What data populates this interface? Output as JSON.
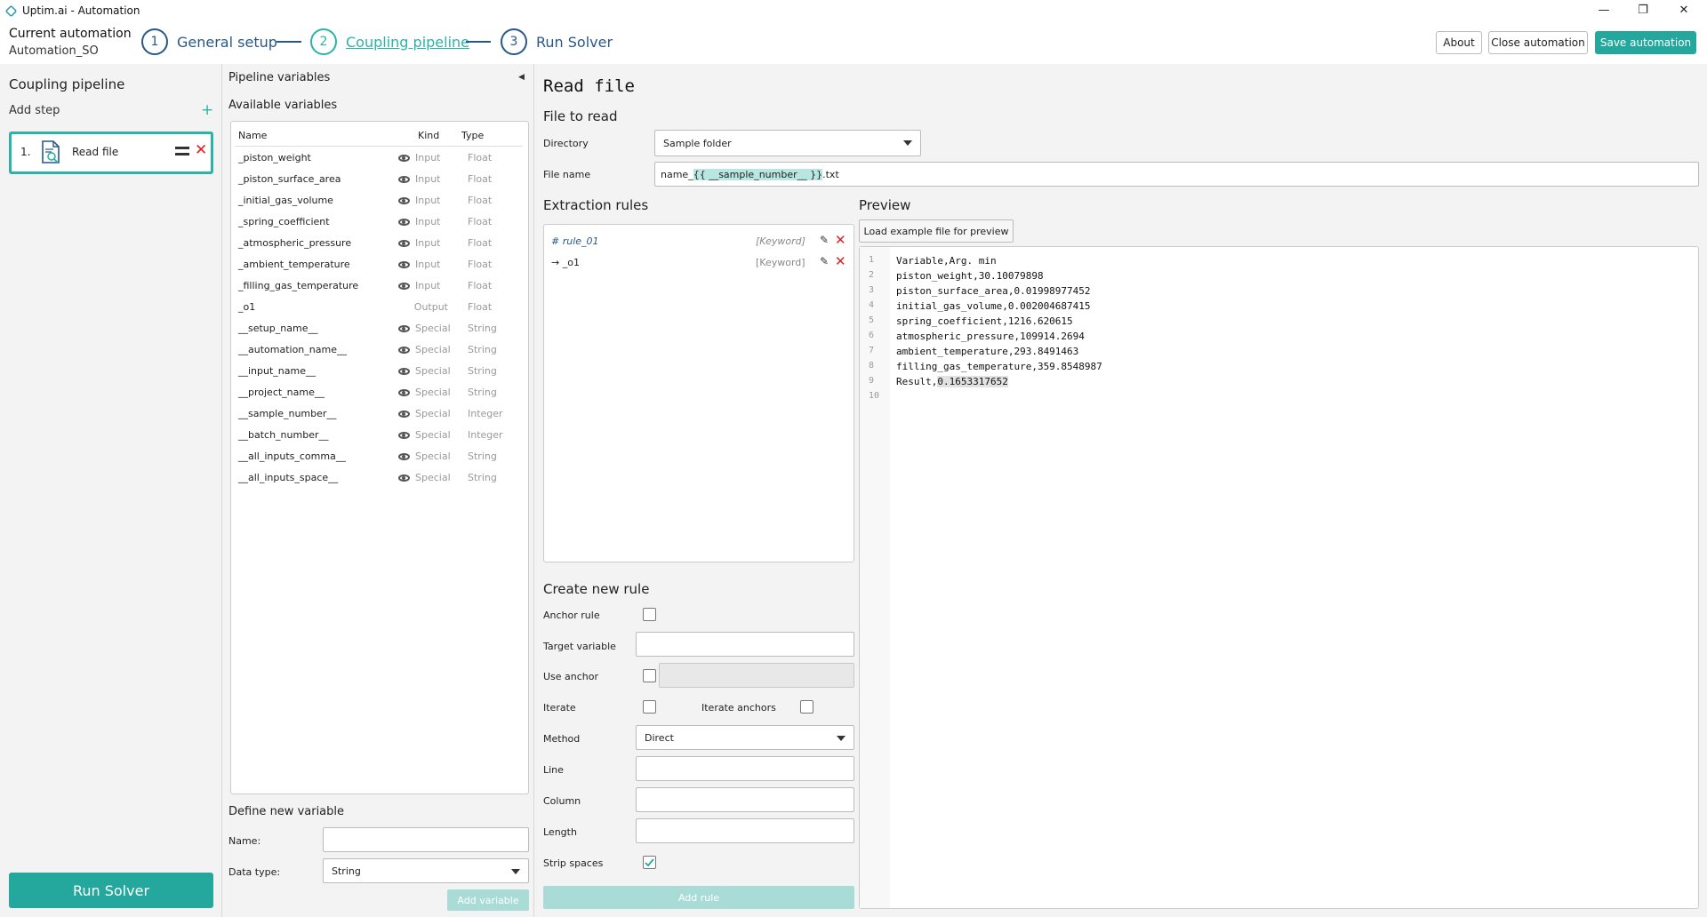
{
  "window": {
    "title": "Uptim.ai - Automation",
    "minimize": "—",
    "restore": "❐",
    "close": "✕"
  },
  "header": {
    "current_label": "Current automation",
    "current_name": "Automation_SO",
    "steps": [
      {
        "num": "1",
        "label": "General setup"
      },
      {
        "num": "2",
        "label": "Coupling pipeline"
      },
      {
        "num": "3",
        "label": "Run Solver"
      }
    ],
    "about": "About",
    "close_automation": "Close automation",
    "save_automation": "Save automation"
  },
  "sidebar": {
    "title": "Coupling pipeline",
    "add_step": "Add step",
    "plus": "+",
    "step": {
      "num": "1.",
      "name": "Read file",
      "delete": "✕"
    },
    "run_solver": "Run Solver"
  },
  "variables": {
    "panel_title": "Pipeline variables",
    "collapse": "◀",
    "available_title": "Available variables",
    "columns": {
      "name": "Name",
      "kind": "Kind",
      "type": "Type"
    },
    "rows": [
      {
        "name": "_piston_weight",
        "kind": "Input",
        "type": "Float",
        "eye": true
      },
      {
        "name": "_piston_surface_area",
        "kind": "Input",
        "type": "Float",
        "eye": true
      },
      {
        "name": "_initial_gas_volume",
        "kind": "Input",
        "type": "Float",
        "eye": true
      },
      {
        "name": "_spring_coefficient",
        "kind": "Input",
        "type": "Float",
        "eye": true
      },
      {
        "name": "_atmospheric_pressure",
        "kind": "Input",
        "type": "Float",
        "eye": true
      },
      {
        "name": "_ambient_temperature",
        "kind": "Input",
        "type": "Float",
        "eye": true
      },
      {
        "name": "_filling_gas_temperature",
        "kind": "Input",
        "type": "Float",
        "eye": true
      },
      {
        "name": "_o1",
        "kind": "Output",
        "type": "Float",
        "eye": false
      },
      {
        "name": "__setup_name__",
        "kind": "Special",
        "type": "String",
        "eye": true
      },
      {
        "name": "__automation_name__",
        "kind": "Special",
        "type": "String",
        "eye": true
      },
      {
        "name": "__input_name__",
        "kind": "Special",
        "type": "String",
        "eye": true
      },
      {
        "name": "__project_name__",
        "kind": "Special",
        "type": "String",
        "eye": true
      },
      {
        "name": "__sample_number__",
        "kind": "Special",
        "type": "Integer",
        "eye": true
      },
      {
        "name": "__batch_number__",
        "kind": "Special",
        "type": "Integer",
        "eye": true
      },
      {
        "name": "__all_inputs_comma__",
        "kind": "Special",
        "type": "String",
        "eye": true
      },
      {
        "name": "__all_inputs_space__",
        "kind": "Special",
        "type": "String",
        "eye": true
      }
    ],
    "define_title": "Define new variable",
    "name_label": "Name:",
    "datatype_label": "Data type:",
    "datatype_value": "String",
    "add_variable": "Add variable"
  },
  "main": {
    "title": "Read file",
    "file_to_read": "File to read",
    "directory_label": "Directory",
    "directory_value": "Sample folder",
    "filename_label": "File name",
    "filename_prefix": "name_",
    "filename_token": "{{ __sample_number__ }}",
    "filename_suffix": ".txt",
    "extraction_title": "Extraction rules",
    "rules": [
      {
        "name": "# rule_01",
        "tag": "[Keyword]"
      },
      {
        "name": "→ _o1",
        "tag": "[Keyword]"
      }
    ],
    "create_title": "Create new rule",
    "anchor_rule": "Anchor rule",
    "target_variable": "Target variable",
    "use_anchor": "Use anchor",
    "iterate": "Iterate",
    "iterate_anchors": "Iterate anchors",
    "method_label": "Method",
    "method_value": "Direct",
    "line_label": "Line",
    "column_label": "Column",
    "length_label": "Length",
    "strip_spaces": "Strip spaces",
    "add_rule": "Add rule",
    "preview_title": "Preview",
    "load_preview": "Load example file for preview",
    "preview_lines": [
      "Variable,Arg. min",
      "piston_weight,30.10079898",
      "piston_surface_area,0.01998977452",
      "initial_gas_volume,0.002004687415",
      "spring_coefficient,1216.620615",
      "atmospheric_pressure,109914.2694",
      "ambient_temperature,293.8491463",
      "filling_gas_temperature,359.8548987",
      "Result,",
      ""
    ],
    "highlighted_value": "0.1653317652",
    "line_numbers": [
      "1",
      "2",
      "3",
      "4",
      "5",
      "6",
      "7",
      "8",
      "9",
      "10"
    ]
  },
  "colors": {
    "accent": "#24a79d",
    "step": "#28588a",
    "delete": "#e02020"
  }
}
